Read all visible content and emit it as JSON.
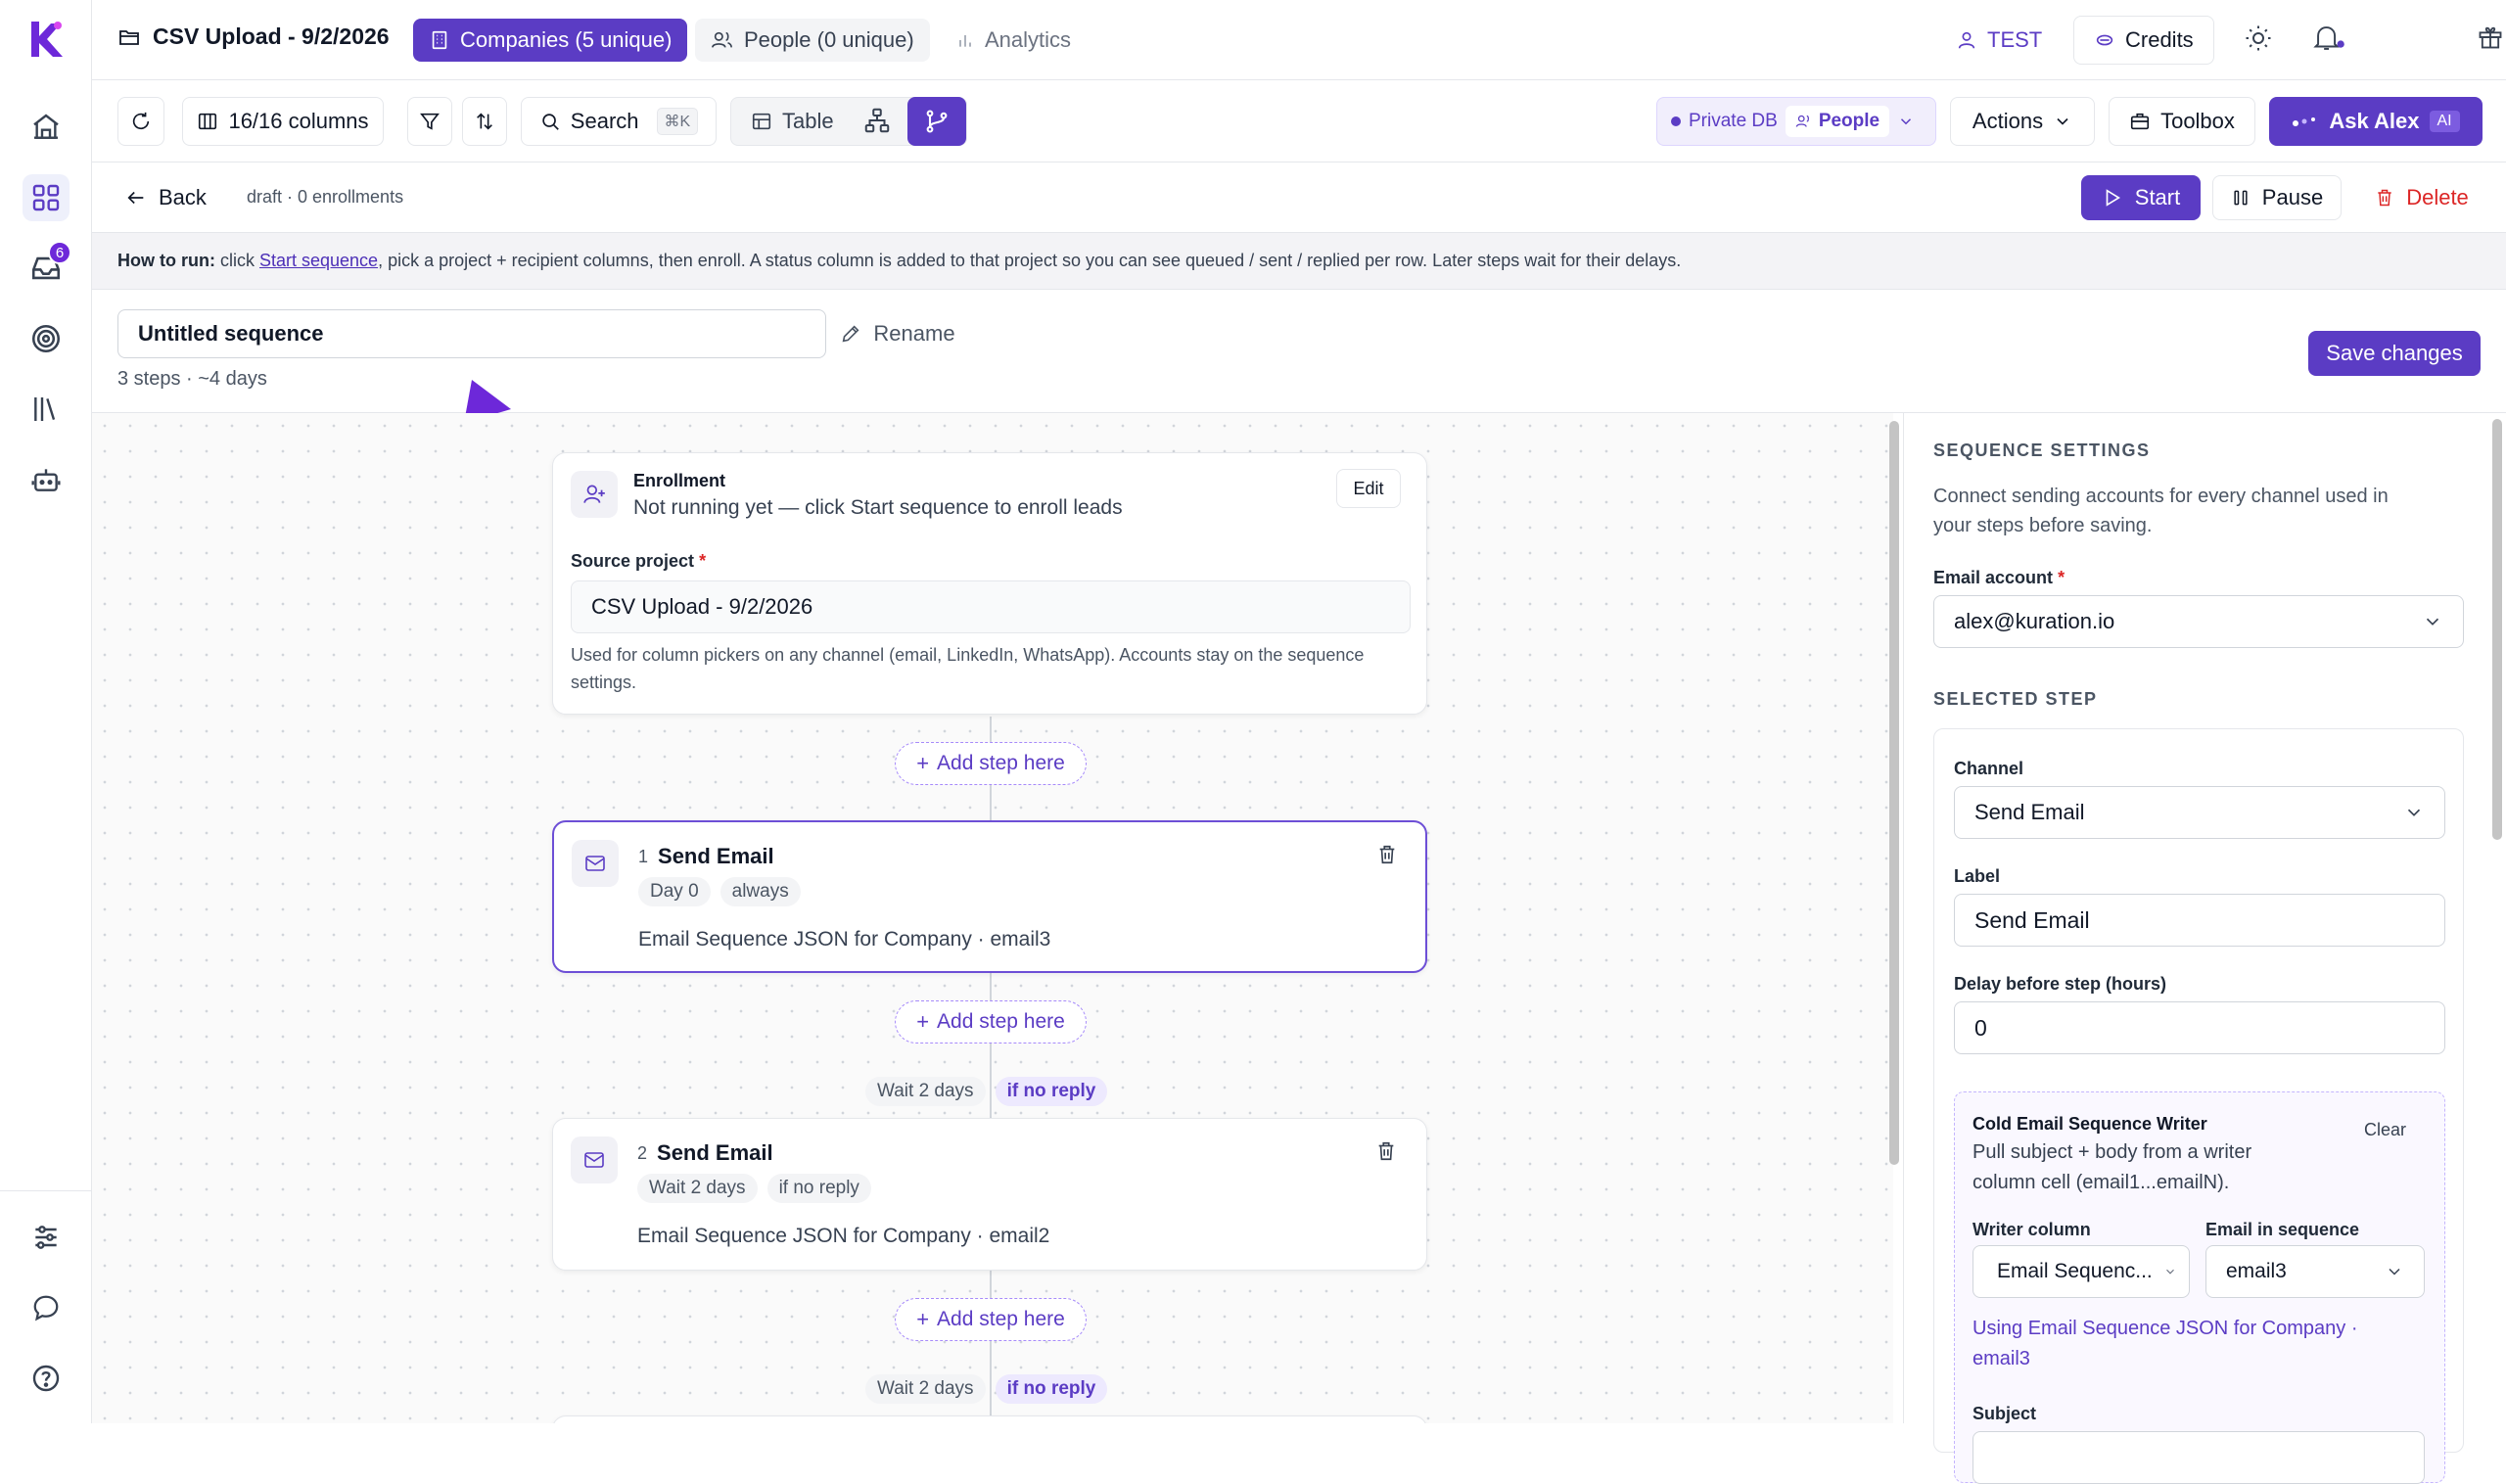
{
  "app": {
    "project_title": "CSV Upload - 9/2/2026",
    "tabs": {
      "companies": "Companies (5 unique)",
      "people": "People (0 unique)",
      "analytics": "Analytics"
    },
    "inbox_badge": "6",
    "workspace": "TEST",
    "credits": "Credits"
  },
  "toolbar": {
    "columns": "16/16 columns",
    "search": "Search",
    "search_shortcut": "⌘K",
    "table": "Table",
    "db_label": "Private DB",
    "db_entity": "People",
    "actions": "Actions",
    "toolbox": "Toolbox",
    "ask": "Ask Alex",
    "ask_badge": "AI"
  },
  "subheader": {
    "back": "Back",
    "status": "draft · 0 enrollments",
    "start": "Start",
    "pause": "Pause",
    "delete": "Delete"
  },
  "howto": {
    "prefix": "How to run:",
    "text1": " click ",
    "link": "Start sequence",
    "text2": ", pick a project + recipient columns, then enroll. A status column is added to that project so you can see queued / sent / replied per row. Later steps wait for their delays."
  },
  "sequence": {
    "name": "Untitled sequence",
    "rename": "Rename",
    "meta": "3 steps · ~4 days",
    "save": "Save changes"
  },
  "enrollment": {
    "title": "Enrollment",
    "subtitle": "Not running yet — click Start sequence to enroll leads",
    "edit": "Edit",
    "source_label": "Source project",
    "source_value": "CSV Upload - 9/2/2026",
    "help": "Used for column pickers on any channel (email, LinkedIn, WhatsApp). Accounts stay on the sequence settings."
  },
  "add_step": "Add step here",
  "steps": [
    {
      "num": "1",
      "title": "Send Email",
      "chip1": "Day 0",
      "chip2": "always",
      "desc": "Email Sequence JSON for Company · email3"
    },
    {
      "num": "2",
      "title": "Send Email",
      "chip1": "Wait 2 days",
      "chip2": "if no reply",
      "desc": "Email Sequence JSON for Company · email2"
    }
  ],
  "waits": [
    {
      "wait": "Wait 2 days",
      "cond": "if no reply"
    },
    {
      "wait": "Wait 2 days",
      "cond": "if no reply"
    }
  ],
  "panel": {
    "settings_title": "SEQUENCE SETTINGS",
    "settings_desc_1": "Connect sending accounts for every channel used in",
    "settings_desc_2": "your steps before saving.",
    "email_account_label": "Email account",
    "email_account": "alex@kuration.io",
    "selected_step_title": "SELECTED STEP",
    "channel_label": "Channel",
    "channel": "Send Email",
    "label_label": "Label",
    "label_value": "Send Email",
    "delay_label": "Delay before step (hours)",
    "delay_value": "0",
    "writer_title": "Cold Email Sequence Writer",
    "writer_clear": "Clear",
    "writer_desc_1": "Pull subject + body from a writer",
    "writer_desc_2": "column cell (email1...emailN).",
    "writer_col_label": "Writer column",
    "writer_col": "Email Sequenc...",
    "email_in_seq_label": "Email in sequence",
    "email_in_seq": "email3",
    "using_1": "Using Email Sequence JSON for Company ·",
    "using_2": "email3",
    "subject_label": "Subject"
  },
  "colors": {
    "accent": "#5b3cc4",
    "danger": "#dc2626",
    "brand": "#6d28d9"
  }
}
